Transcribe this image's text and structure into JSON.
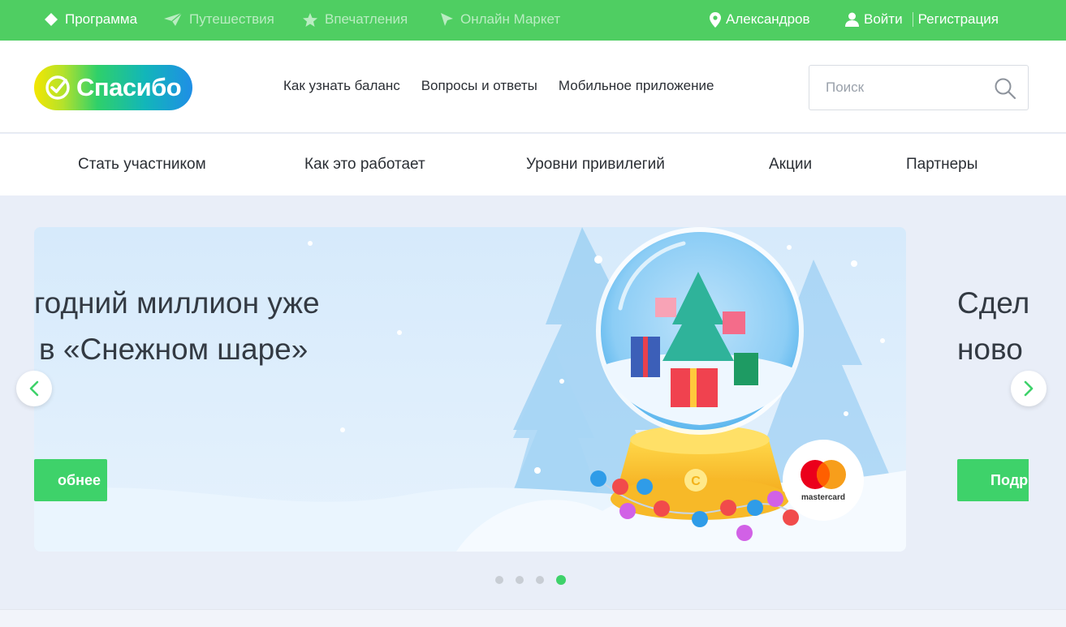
{
  "topbar": {
    "nav": [
      {
        "label": "Программа",
        "icon": "diamond-icon"
      },
      {
        "label": "Путешествия",
        "icon": "paper-plane-icon"
      },
      {
        "label": "Впечатления",
        "icon": "star-icon"
      },
      {
        "label": "Онлайн Маркет",
        "icon": "cursor-icon"
      }
    ],
    "city": "Александров",
    "login": "Войти",
    "register": "Регистрация"
  },
  "header": {
    "logo_text": "Спасибо",
    "links": [
      "Как узнать баланс",
      "Вопросы и ответы",
      "Мобильное приложение"
    ],
    "search_placeholder": "Поиск"
  },
  "section_nav": [
    "Стать участником",
    "Как это работает",
    "Уровни привилегий",
    "Акции",
    "Партнеры"
  ],
  "carousel": {
    "slide_main": {
      "title_line1": "годний миллион уже",
      "title_line2": "в «Снежном шаре»",
      "button": "обнее",
      "globe_badge": "С",
      "card_brand": "mastercard"
    },
    "slide_next": {
      "title_line1": "Сдел",
      "title_line2": "ново",
      "button": "Подр"
    },
    "dots_count": 4,
    "active_dot": 4
  },
  "colors": {
    "brand_green": "#4fce62",
    "button_green": "#3ed26a",
    "text_dark": "#2b2f35"
  }
}
